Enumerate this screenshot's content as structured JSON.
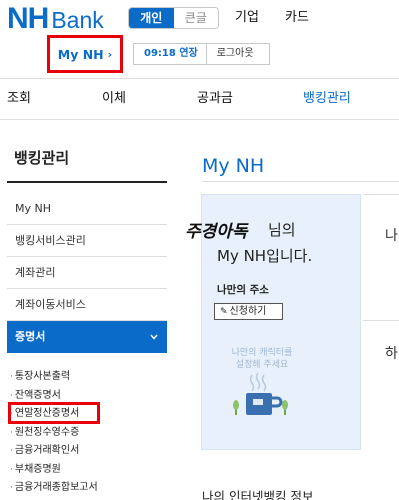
{
  "brand": {
    "logo_main": "NH",
    "logo_sub": "Bank"
  },
  "header": {
    "segment": [
      "개인",
      "큰글"
    ],
    "links": [
      "기업",
      "카드"
    ]
  },
  "my_nh": {
    "label": "My NH",
    "chevron": "›"
  },
  "session": {
    "time": "09:18 연장",
    "logout": "로그아웃"
  },
  "gnb": [
    "조회",
    "이체",
    "공과금",
    "뱅킹관리"
  ],
  "sidebar": {
    "title": "뱅킹관리",
    "items": [
      "My NH",
      "뱅킹서비스관리",
      "계좌관리",
      "계좌이동서비스"
    ],
    "active_item": "증명서",
    "active_icon": "chevron-down-icon",
    "sub_items": [
      "통장사본출력",
      "잔액증명서",
      "연말정산증명서",
      "원천징수영수증",
      "금융거래확인서",
      "부채증명원",
      "금융거래종합보고서"
    ]
  },
  "main": {
    "title": "My NH",
    "greeting": {
      "name": "주경아독",
      "suffix": "님의",
      "line2": "My NH입니다."
    },
    "address_title": "나만의 주소",
    "apply_button": "신청하기",
    "character_text": [
      "나만의 캐릭터를",
      "설정해 주세요"
    ],
    "right_label_1": "나",
    "right_label_2": "하",
    "bottom_title": "나의 인터넷뱅킹 정보"
  },
  "colors": {
    "brand_blue": "#0a6bc9",
    "highlight_red": "#e8000b",
    "card_bg": "#e8f1fb"
  }
}
